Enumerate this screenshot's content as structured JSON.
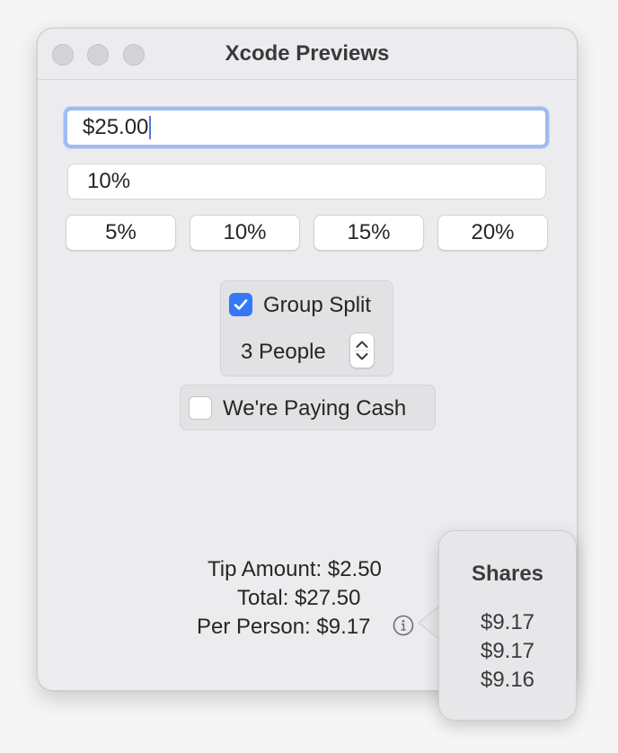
{
  "window": {
    "title": "Xcode Previews"
  },
  "bill": {
    "amount": "$25.00"
  },
  "tip": {
    "percent": "10%"
  },
  "tip_presets": [
    "5%",
    "10%",
    "15%",
    "20%"
  ],
  "group": {
    "split_label": "Group Split",
    "split_checked": true,
    "people_label": "3 People",
    "paying_cash_label": "We're Paying Cash",
    "paying_cash_checked": false
  },
  "results": {
    "tip_amount": "Tip Amount: $2.50",
    "total": "Total: $27.50",
    "per_person": "Per Person: $9.17"
  },
  "shares_popover": {
    "title": "Shares",
    "values": [
      "$9.17",
      "$9.17",
      "$9.16"
    ]
  },
  "colors": {
    "accent": "#3478f6",
    "focus_ring": "#9ebcf0"
  }
}
